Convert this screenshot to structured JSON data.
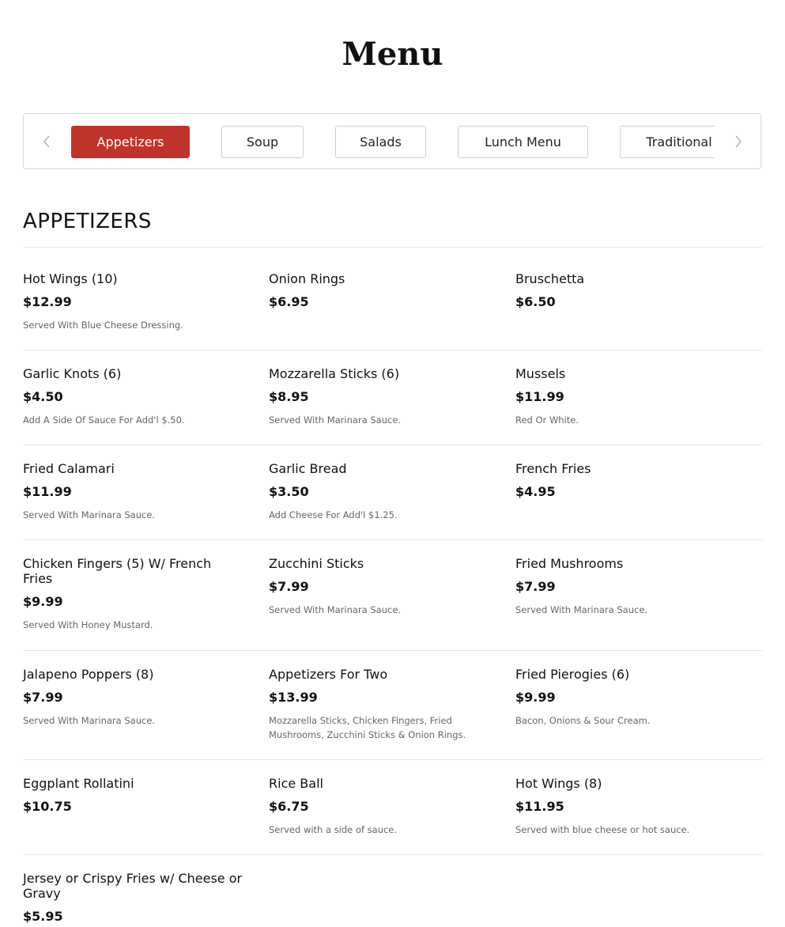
{
  "page": {
    "title": "Menu"
  },
  "tabs": [
    {
      "label": "Appetizers",
      "active": true
    },
    {
      "label": "Soup",
      "active": false
    },
    {
      "label": "Salads",
      "active": false
    },
    {
      "label": "Lunch Menu",
      "active": false
    },
    {
      "label": "Traditional",
      "active": false
    }
  ],
  "icons": {
    "prev": "chevron-left-icon",
    "next": "chevron-right-icon"
  },
  "colors": {
    "accent": "#c0332b",
    "text": "#111111",
    "muted": "#666666",
    "divider": "#e6e6e6"
  },
  "section": {
    "title": "APPETIZERS",
    "items": [
      {
        "name": "Hot Wings (10)",
        "price": "$12.99",
        "desc": "Served With Blue Cheese Dressing."
      },
      {
        "name": "Onion Rings",
        "price": "$6.95",
        "desc": ""
      },
      {
        "name": "Bruschetta",
        "price": "$6.50",
        "desc": ""
      },
      {
        "name": "Garlic Knots (6)",
        "price": "$4.50",
        "desc": "Add A Side Of Sauce For Add'l $.50."
      },
      {
        "name": "Mozzarella Sticks (6)",
        "price": "$8.95",
        "desc": "Served With Marinara Sauce."
      },
      {
        "name": "Mussels",
        "price": "$11.99",
        "desc": "Red Or White."
      },
      {
        "name": "Fried Calamari",
        "price": "$11.99",
        "desc": "Served With Marinara Sauce."
      },
      {
        "name": "Garlic Bread",
        "price": "$3.50",
        "desc": "Add Cheese For Add'l $1.25."
      },
      {
        "name": "French Fries",
        "price": "$4.95",
        "desc": ""
      },
      {
        "name": "Chicken Fingers (5) W/ French Fries",
        "price": "$9.99",
        "desc": "Served With Honey Mustard."
      },
      {
        "name": "Zucchini Sticks",
        "price": "$7.99",
        "desc": "Served With Marinara Sauce."
      },
      {
        "name": "Fried Mushrooms",
        "price": "$7.99",
        "desc": "Served With Marinara Sauce."
      },
      {
        "name": "Jalapeno Poppers (8)",
        "price": "$7.99",
        "desc": "Served With Marinara Sauce."
      },
      {
        "name": "Appetizers For Two",
        "price": "$13.99",
        "desc": "Mozzarella Sticks, Chicken Fingers, Fried Mushrooms, Zucchini Sticks & Onion Rings."
      },
      {
        "name": "Fried Pierogies (6)",
        "price": "$9.99",
        "desc": "Bacon, Onions & Sour Cream."
      },
      {
        "name": "Eggplant Rollatini",
        "price": "$10.75",
        "desc": ""
      },
      {
        "name": "Rice Ball",
        "price": "$6.75",
        "desc": "Served with a side of sauce."
      },
      {
        "name": "Hot Wings (8)",
        "price": "$11.95",
        "desc": "Served with blue cheese or hot sauce."
      },
      {
        "name": "Jersey or Crispy Fries w/ Cheese or Gravy",
        "price": "$5.95",
        "desc": ""
      }
    ]
  }
}
